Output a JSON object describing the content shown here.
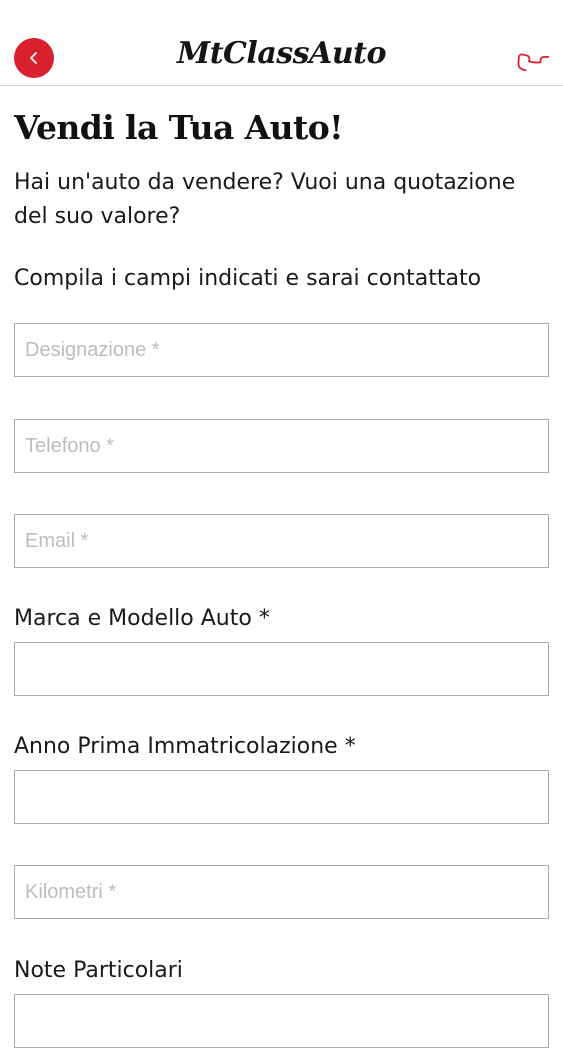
{
  "header": {
    "back_icon": "chevron-left-icon",
    "logo_text": "MtClassAuto",
    "phone_icon": "phone-icon",
    "accent_color": "#d8202f"
  },
  "page": {
    "title": "Vendi la Tua Auto!",
    "intro": "Hai un'auto da vendere? Vuoi una quotazione del suo valore?",
    "instruction": "Compila i campi indicati e sarai contattato"
  },
  "form": {
    "designazione_placeholder": "Designazione *",
    "telefono_placeholder": "Telefono *",
    "email_placeholder": "Email *",
    "marca_label": "Marca e Modello Auto *",
    "anno_label": "Anno Prima Immatricolazione *",
    "kilometri_placeholder": "Kilometri *",
    "note_label": "Note Particolari"
  }
}
